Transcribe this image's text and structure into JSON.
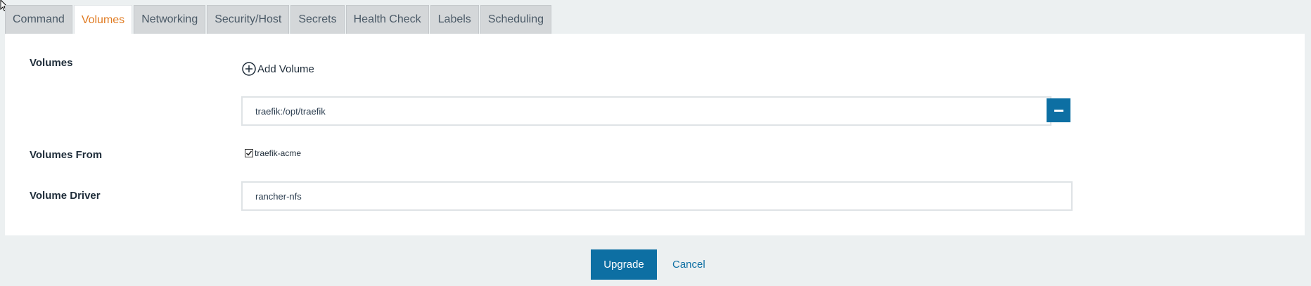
{
  "tabs": [
    {
      "label": "Command",
      "active": false
    },
    {
      "label": "Volumes",
      "active": true
    },
    {
      "label": "Networking",
      "active": false
    },
    {
      "label": "Security/Host",
      "active": false
    },
    {
      "label": "Secrets",
      "active": false
    },
    {
      "label": "Health Check",
      "active": false
    },
    {
      "label": "Labels",
      "active": false
    },
    {
      "label": "Scheduling",
      "active": false
    }
  ],
  "volumes": {
    "label": "Volumes",
    "add_label": "Add Volume",
    "items": [
      "traefik:/opt/traefik"
    ]
  },
  "volumes_from": {
    "label": "Volumes From",
    "option_label": "traefik-acme",
    "checked": true
  },
  "volume_driver": {
    "label": "Volume Driver",
    "value": "rancher-nfs"
  },
  "footer": {
    "upgrade_label": "Upgrade",
    "cancel_label": "Cancel"
  },
  "colors": {
    "accent": "#0d6fa3",
    "active_tab": "#e07b22"
  }
}
